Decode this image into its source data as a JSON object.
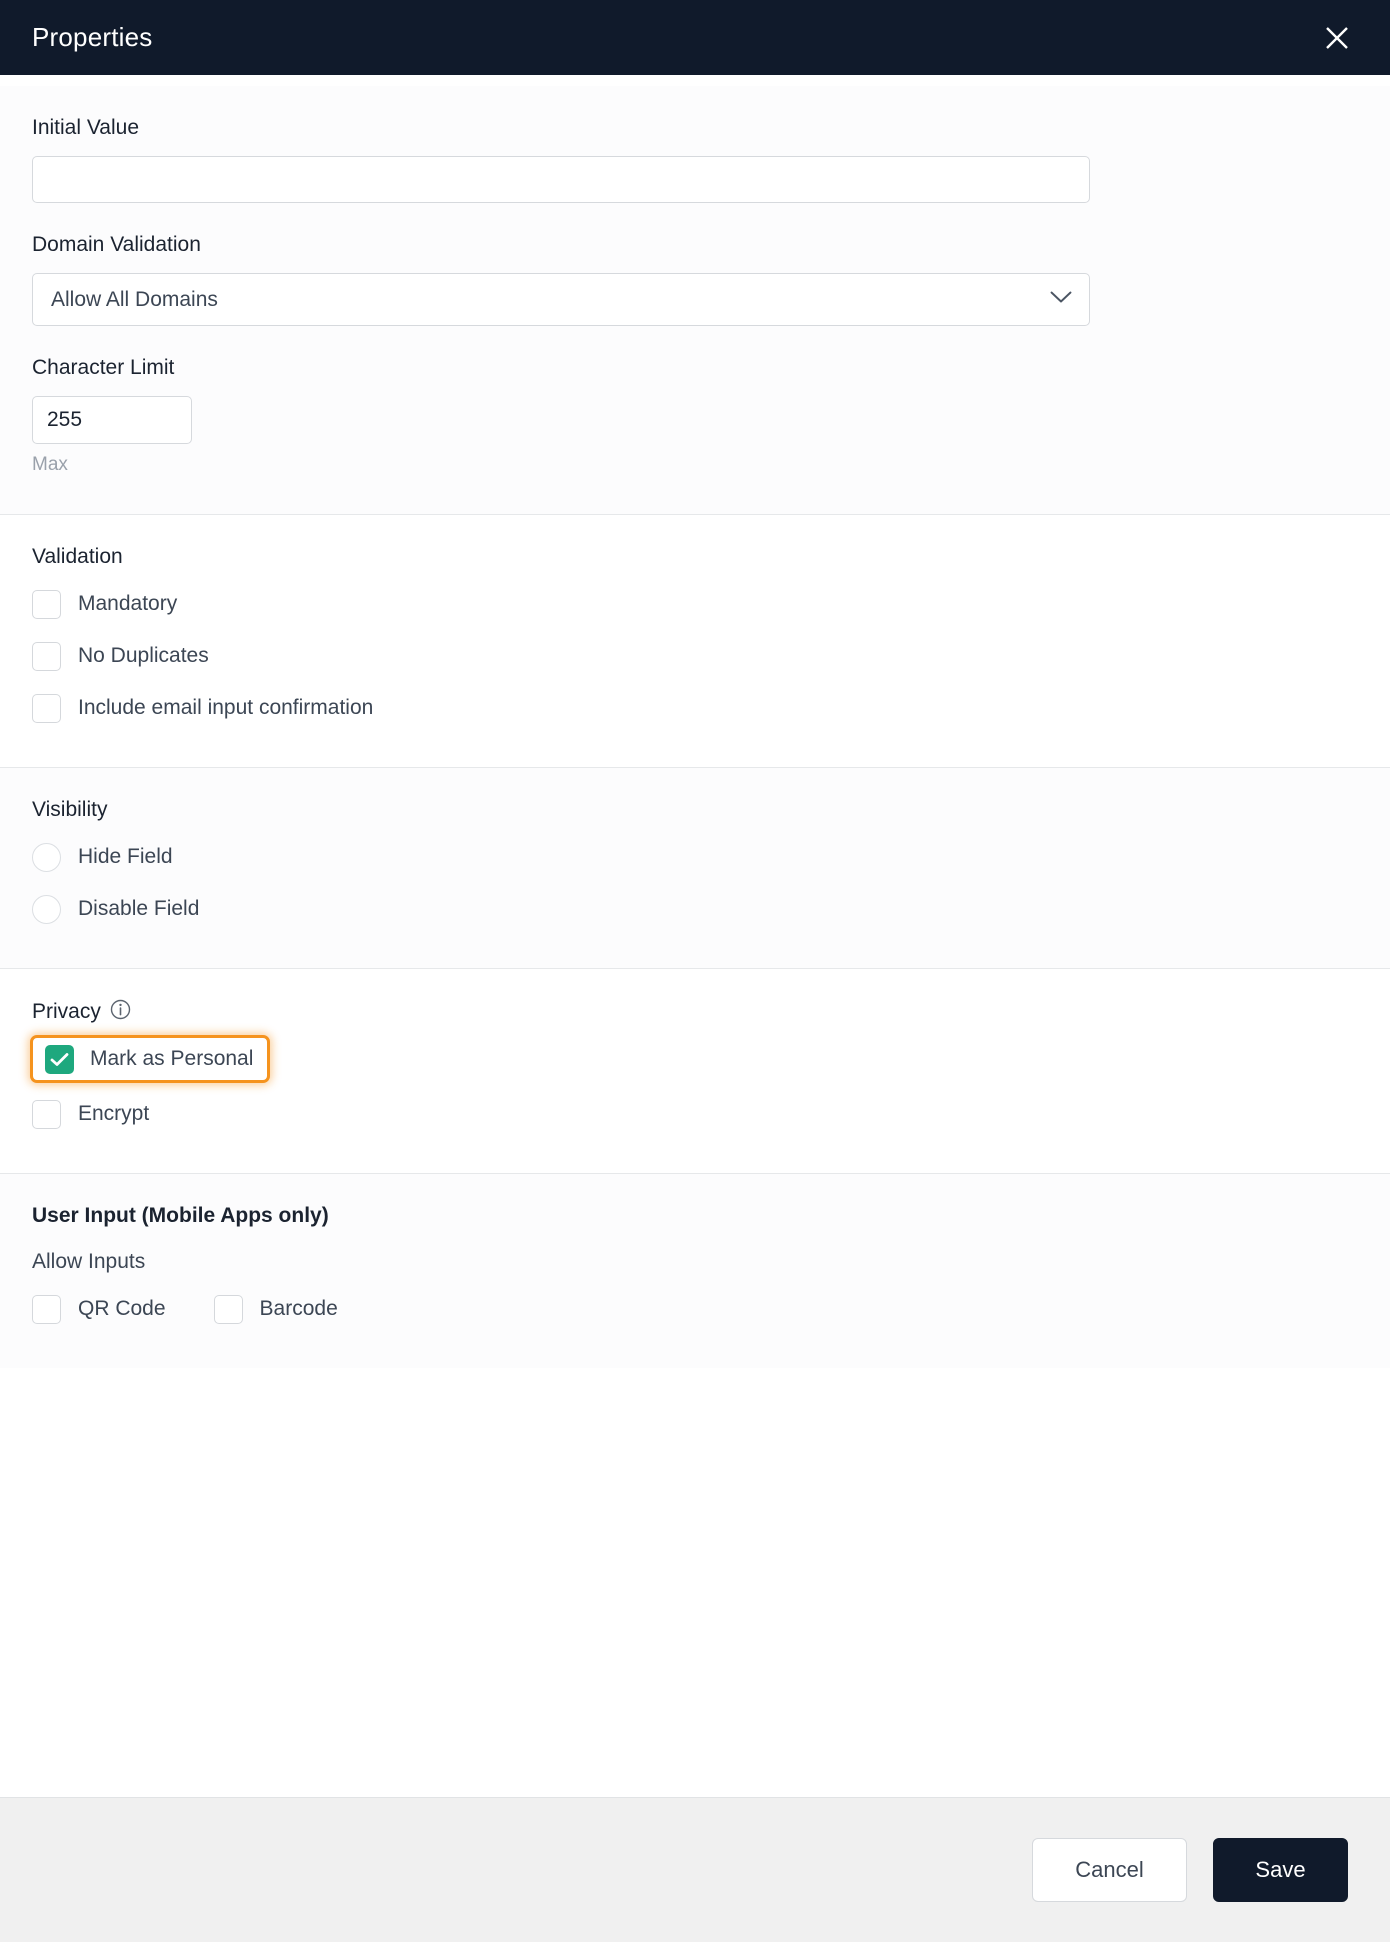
{
  "dialog": {
    "title": "Properties",
    "close_icon": "close-icon"
  },
  "basic": {
    "initial_value": {
      "label": "Initial Value",
      "value": "",
      "placeholder": ""
    },
    "domain_validation": {
      "label": "Domain Validation",
      "selected": "Allow All Domains",
      "chevron_icon": "chevron-down-icon"
    },
    "character_limit": {
      "label": "Character Limit",
      "value": "255",
      "helper": "Max"
    }
  },
  "validation": {
    "label": "Validation",
    "options": [
      {
        "label": "Mandatory",
        "checked": false
      },
      {
        "label": "No Duplicates",
        "checked": false
      },
      {
        "label": "Include email input confirmation",
        "checked": false
      }
    ]
  },
  "visibility": {
    "label": "Visibility",
    "options": [
      {
        "label": "Hide Field",
        "selected": false
      },
      {
        "label": "Disable Field",
        "selected": false
      }
    ]
  },
  "privacy": {
    "label": "Privacy",
    "info_icon": "info-icon",
    "options": [
      {
        "label": "Mark as Personal",
        "checked": true,
        "highlighted": true
      },
      {
        "label": "Encrypt",
        "checked": false,
        "highlighted": false
      }
    ],
    "highlight_color": "#f5931e",
    "checkbox_color": "#1ea87e"
  },
  "user_input": {
    "title": "User Input (Mobile Apps only)",
    "allow_label": "Allow Inputs",
    "options": [
      {
        "label": "QR Code",
        "checked": false
      },
      {
        "label": "Barcode",
        "checked": false
      }
    ]
  },
  "footer": {
    "cancel_label": "Cancel",
    "save_label": "Save"
  }
}
